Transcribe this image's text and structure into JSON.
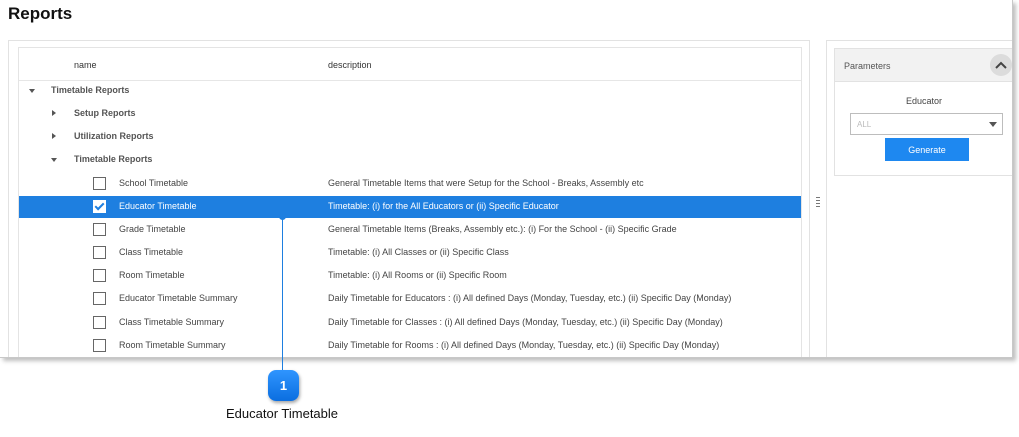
{
  "page": {
    "title": "Reports"
  },
  "grid": {
    "columns": {
      "name": "name",
      "description": "description"
    },
    "groups": {
      "top": "Timetable Reports",
      "setup": "Setup Reports",
      "utilization": "Utilization Reports",
      "timetable": "Timetable Reports"
    },
    "rows": [
      {
        "name": "School Timetable",
        "description": "General Timetable Items that were Setup for the School - Breaks, Assembly etc",
        "checked": false
      },
      {
        "name": "Educator Timetable",
        "description": "Timetable: (i) for the All Educators or (ii) Specific Educator",
        "checked": true
      },
      {
        "name": "Grade Timetable",
        "description": "General Timetable Items (Breaks, Assembly etc.): (i) For the School - (ii) Specific Grade",
        "checked": false
      },
      {
        "name": "Class Timetable",
        "description": "Timetable: (i) All Classes or (ii) Specific Class",
        "checked": false
      },
      {
        "name": "Room Timetable",
        "description": "Timetable: (i) All Rooms or (ii) Specific Room",
        "checked": false
      },
      {
        "name": "Educator Timetable Summary",
        "description": "Daily Timetable for Educators : (i) All defined Days (Monday, Tuesday, etc.) (ii) Specific Day (Monday)",
        "checked": false
      },
      {
        "name": "Class Timetable Summary",
        "description": "Daily Timetable for Classes : (i) All defined Days (Monday, Tuesday, etc.) (ii) Specific Day (Monday)",
        "checked": false
      },
      {
        "name": "Room Timetable Summary",
        "description": "Daily Timetable for Rooms : (i) All defined Days (Monday, Tuesday, etc.) (ii) Specific Day (Monday)",
        "checked": false
      }
    ]
  },
  "parameters": {
    "title": "Parameters",
    "educator_label": "Educator",
    "educator_value": "ALL",
    "generate_label": "Generate"
  },
  "callout": {
    "number": "1",
    "text": "Educator Timetable"
  },
  "colors": {
    "accent": "#1e7fe0",
    "selected_row": "#1e7fe0"
  },
  "icons": {
    "collapse": "chevron-up-icon",
    "expand": "triangle-right-icon",
    "collapse_tree": "triangle-down-icon",
    "splitter": "splitter-handle-icon"
  }
}
